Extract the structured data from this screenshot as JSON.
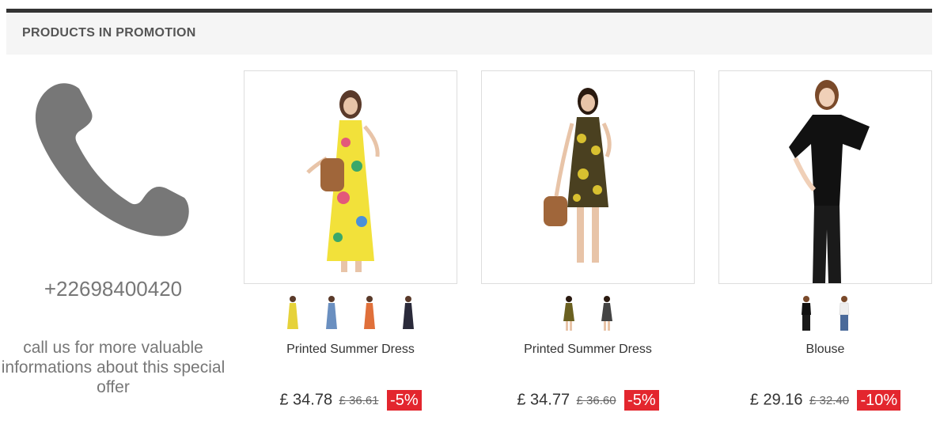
{
  "section": {
    "title": "PRODUCTS IN PROMOTION"
  },
  "contact": {
    "phone": "+22698400420",
    "message": "call us for more valuable informations about this special offer",
    "icon": "phone-icon"
  },
  "products": [
    {
      "name": "Printed Summer Dress",
      "price": "£ 34.78",
      "old_price": "£ 36.61",
      "discount": "-5%"
    },
    {
      "name": "Printed Summer Dress",
      "price": "£ 34.77",
      "old_price": "£ 36.60",
      "discount": "-5%"
    },
    {
      "name": "Blouse",
      "price": "£ 29.16",
      "old_price": "£ 32.40",
      "discount": "-10%"
    }
  ],
  "colors": {
    "discount_badge": "#e3262e",
    "header_bar": "#333333"
  }
}
